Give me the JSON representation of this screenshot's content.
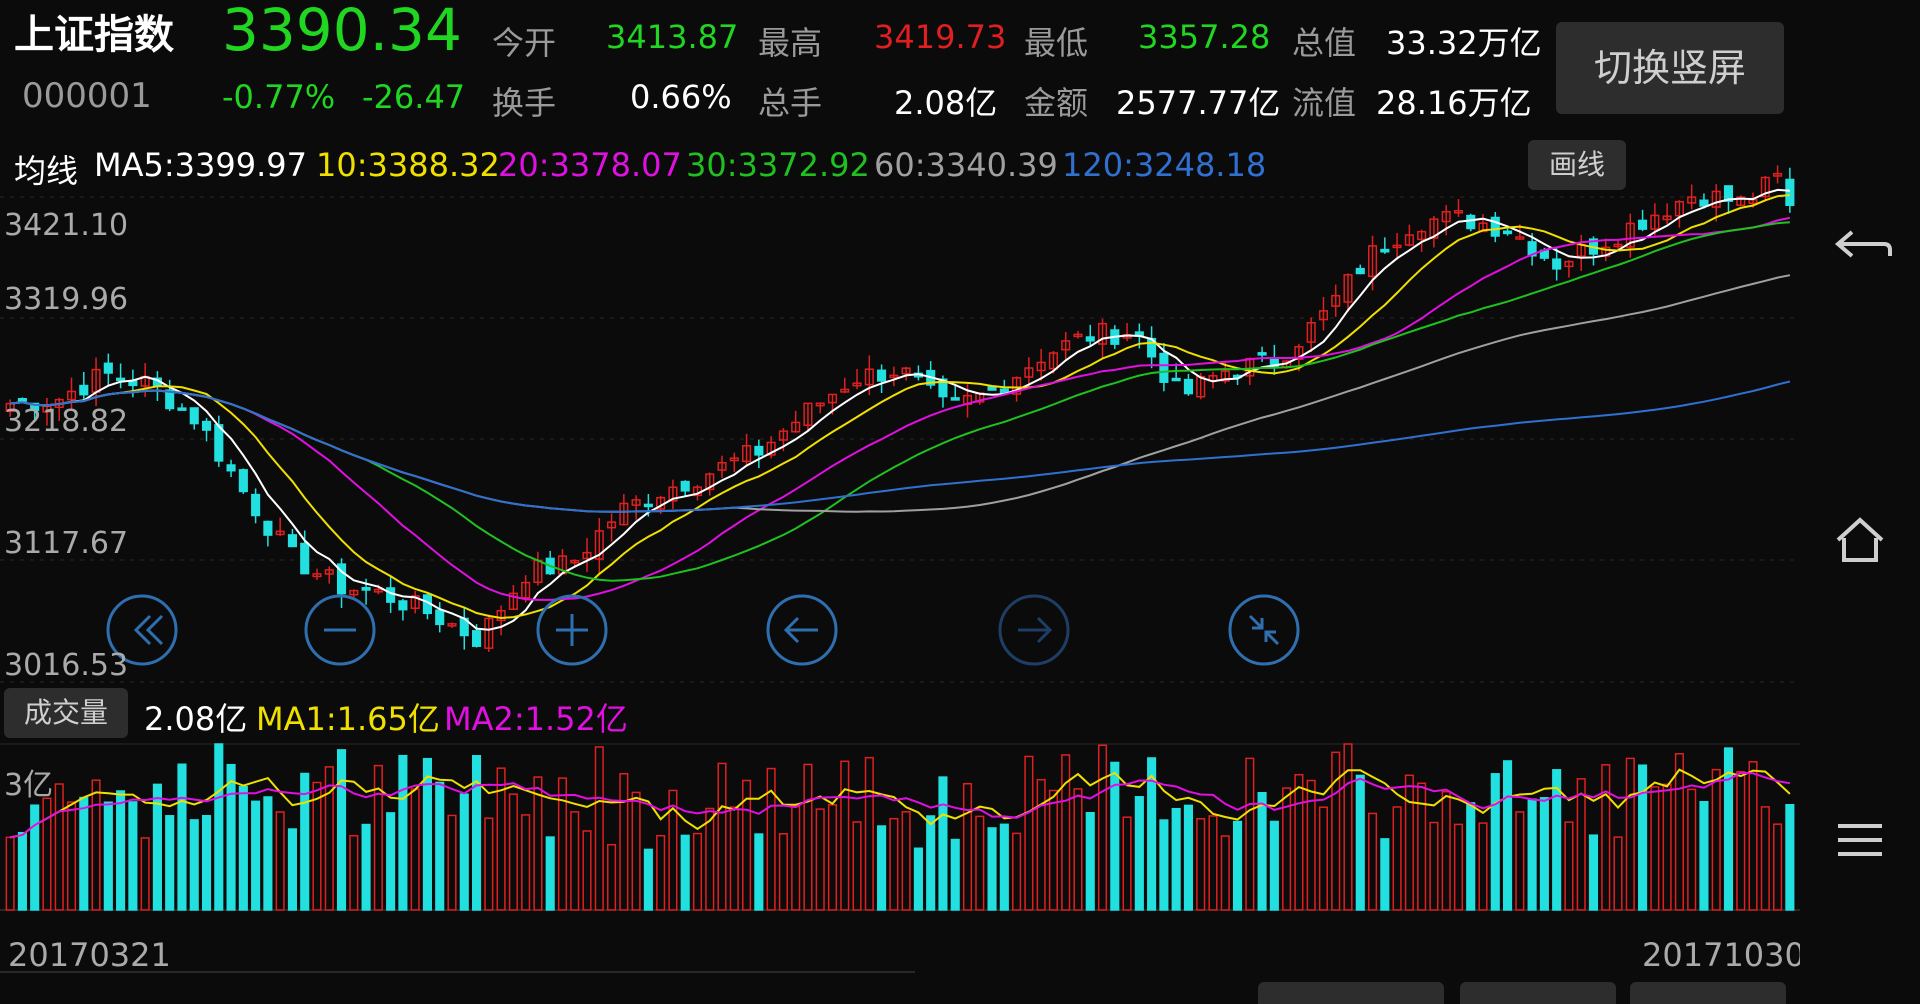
{
  "header": {
    "name": "上证指数",
    "code": "000001",
    "price": "3390.34",
    "change_pct": "-0.77%",
    "change_abs": "-26.47",
    "stats": [
      {
        "label": "今开",
        "value": "3413.87",
        "color": "#21d621"
      },
      {
        "label": "最高",
        "value": "3419.73",
        "color": "#e02020"
      },
      {
        "label": "最低",
        "value": "3357.28",
        "color": "#21d621"
      },
      {
        "label": "总值",
        "value": "33.32万亿",
        "color": "#ffffff"
      },
      {
        "label": "换手",
        "value": "0.66%",
        "color": "#ffffff"
      },
      {
        "label": "总手",
        "value": "2.08亿",
        "color": "#ffffff"
      },
      {
        "label": "金额",
        "value": "2577.77亿",
        "color": "#ffffff"
      },
      {
        "label": "流值",
        "value": "28.16万亿",
        "color": "#ffffff"
      }
    ],
    "switch_button": "切换竖屏"
  },
  "ma_legend": {
    "title": "均线",
    "items": [
      {
        "text": "MA5:3399.97",
        "color": "#ffffff"
      },
      {
        "text": "10:3388.32",
        "color": "#f0e000"
      },
      {
        "text": "20:3378.07",
        "color": "#e010e0"
      },
      {
        "text": "30:3372.92",
        "color": "#20c020"
      },
      {
        "text": "60:3340.39",
        "color": "#a0a0a0"
      },
      {
        "text": "120:3248.18",
        "color": "#3070d0"
      }
    ],
    "draw_button": "画线"
  },
  "volume_legend": {
    "button": "成交量",
    "total": "2.08亿",
    "ma1": "MA1:1.65亿",
    "ma2": "MA2:1.52亿"
  },
  "colors": {
    "up": "#e02020",
    "down": "#22e0e0",
    "bg": "#0b0b0b"
  },
  "icons": [
    "rewind-icon",
    "zoom-out-icon",
    "zoom-in-icon",
    "prev-icon",
    "next-icon",
    "shrink-icon",
    "back-icon",
    "home-icon",
    "menu-icon"
  ],
  "chart_data": {
    "type": "candlestick",
    "price_ticks": [
      "3421.10",
      "3319.96",
      "3218.82",
      "3117.67",
      "3016.53"
    ],
    "price_range": [
      3016.53,
      3421.1
    ],
    "volume_tick": "3亿",
    "start_date": "20170321",
    "end_date": "20171030",
    "control_points": [
      3235,
      3238,
      3258,
      3250,
      3222,
      3165,
      3115,
      3092,
      3085,
      3070,
      3050,
      3102,
      3110,
      3150,
      3168,
      3182,
      3198,
      3228,
      3255,
      3262,
      3230,
      3245,
      3272,
      3288,
      3292,
      3240,
      3262,
      3268,
      3302,
      3350,
      3378,
      3380,
      3372,
      3345,
      3362,
      3382,
      3400,
      3392,
      3418
    ],
    "last_close": 3390.34
  }
}
